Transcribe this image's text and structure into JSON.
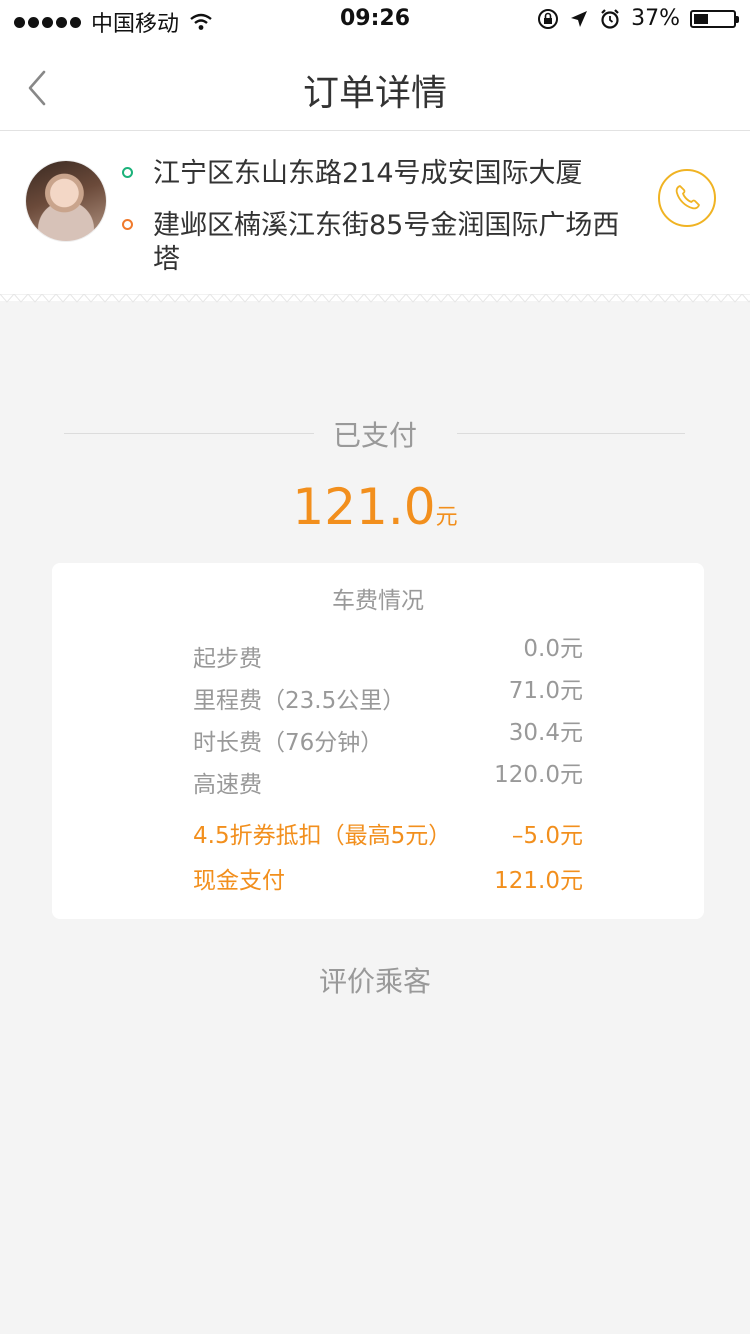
{
  "status_bar": {
    "carrier": "中国移动",
    "time": "09:26",
    "battery": "37%",
    "battery_level": 0.37
  },
  "nav": {
    "title": "订单详情"
  },
  "trip": {
    "start_address": "江宁区东山东路214号成安国际大厦",
    "end_address": "建邺区楠溪江东街85号金润国际广场西塔"
  },
  "payment": {
    "status_label": "已支付",
    "amount": "121.0",
    "unit": "元"
  },
  "fee_details": {
    "title": "车费情况",
    "rows": [
      {
        "label": "起步费",
        "value": "0.0元"
      },
      {
        "label": "里程费（23.5公里）",
        "value": "71.0元"
      },
      {
        "label": "时长费（76分钟）",
        "value": "30.4元"
      },
      {
        "label": "高速费",
        "value": "120.0元"
      },
      {
        "label": "4.5折券抵扣（最高5元）",
        "value": "–5.0元"
      },
      {
        "label": "现金支付",
        "value": "121.0元"
      }
    ]
  },
  "rate_passenger": "评价乘客",
  "colors": {
    "accent": "#f28f1d",
    "start_dot": "#1bb27a",
    "end_dot": "#f07a2c",
    "phone": "#f0b323"
  }
}
